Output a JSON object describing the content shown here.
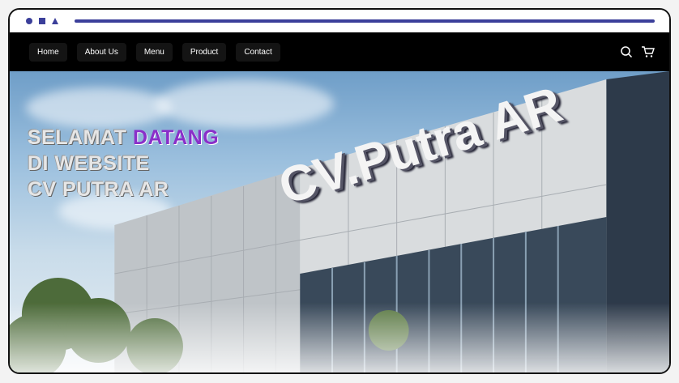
{
  "window": {
    "controls": [
      "circle-icon",
      "square-icon",
      "triangle-icon"
    ]
  },
  "nav": {
    "items": [
      {
        "label": "Home"
      },
      {
        "label": "About Us"
      },
      {
        "label": "Menu"
      },
      {
        "label": "Product"
      },
      {
        "label": "Contact"
      }
    ],
    "icons": [
      "search-icon",
      "cart-icon"
    ]
  },
  "hero": {
    "line1_part1": "SELAMAT",
    "line1_accent": "DATANG",
    "line2": "DI WEBSITE",
    "line3": "CV PUTRA AR",
    "sign_text": "CV.Putra AR"
  },
  "colors": {
    "accent": "#8a2fc9",
    "nav_bg": "#000000",
    "chrome_accent": "#3b3f9a"
  }
}
